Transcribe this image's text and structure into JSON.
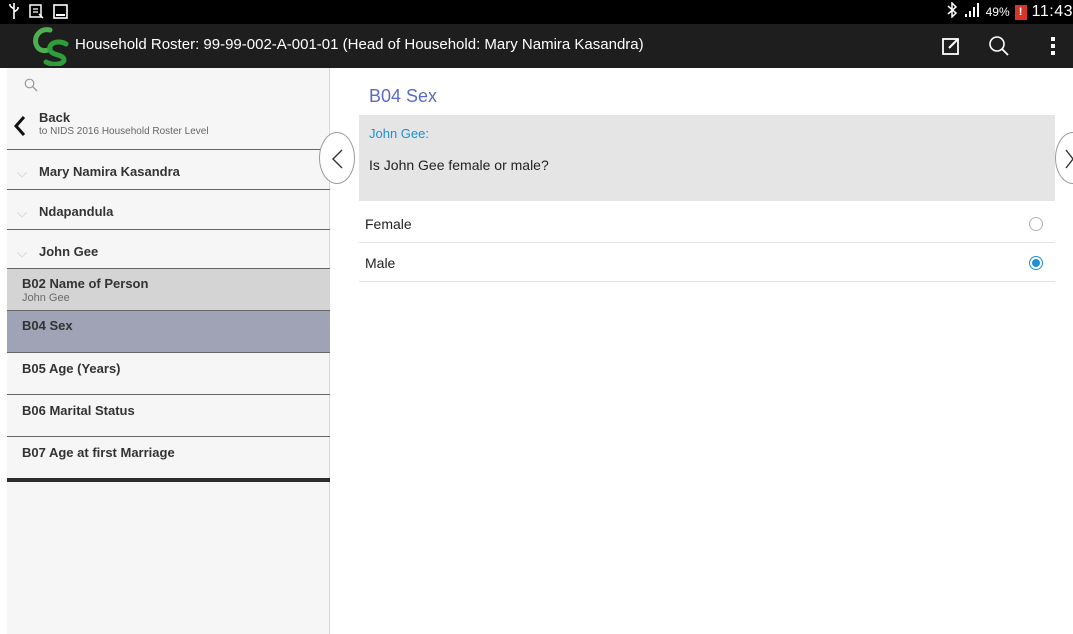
{
  "statusbar": {
    "left_icons": [
      "usb-icon",
      "screenshot-icon",
      "gallery-icon"
    ],
    "battery_percent": "49%",
    "time": "11:43",
    "icons": [
      "bluetooth-icon",
      "signal-icon",
      "battery-warning-icon"
    ]
  },
  "actionbar": {
    "title": "Household Roster: 99-99-002-A-001-01 (Head of Household: Mary Namira Kasandra)",
    "actions": [
      "edit-icon",
      "search-icon",
      "overflow-menu-icon"
    ]
  },
  "sidebar": {
    "back": {
      "label": "Back",
      "sublabel": "to NIDS 2016 Household Roster Level"
    },
    "rosters": [
      {
        "label": "Mary Namira Kasandra"
      },
      {
        "label": "Ndapandula"
      },
      {
        "label": "John Gee"
      }
    ],
    "questions": [
      {
        "label": "B02 Name of Person",
        "value": "John Gee"
      },
      {
        "label": "B04 Sex",
        "value": ""
      },
      {
        "label": "B05 Age (Years)",
        "value": ""
      },
      {
        "label": "B06 Marital Status",
        "value": ""
      },
      {
        "label": "B07 Age at first Marriage",
        "value": ""
      }
    ]
  },
  "question": {
    "title": "B04 Sex",
    "respondent": "John Gee:",
    "text": "Is John Gee female or male?",
    "options": [
      {
        "label": "Female",
        "selected": false
      },
      {
        "label": "Male",
        "selected": true
      }
    ]
  },
  "colors": {
    "accent": "#1f8fd6",
    "title": "#5c6bc0",
    "selected_row": "#a0a2b5",
    "answered_row": "#d4d4d4"
  }
}
